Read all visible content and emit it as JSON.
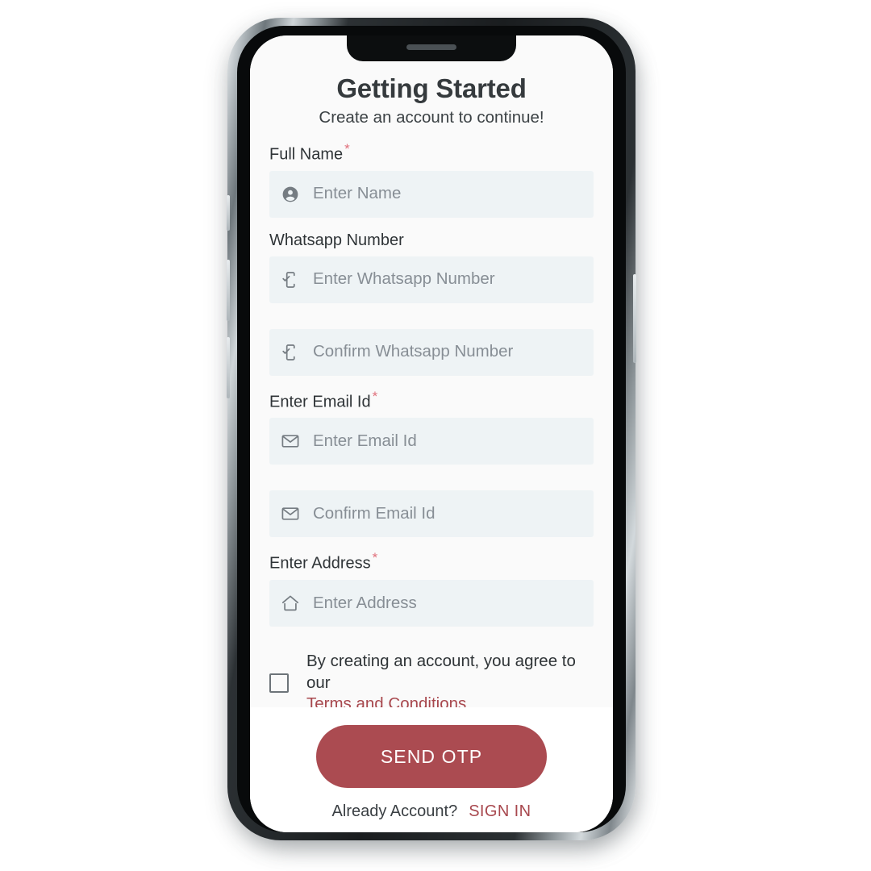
{
  "device": {
    "type": "smartphone-mockup",
    "notch": true,
    "speaker_grille": true
  },
  "screen": {
    "header": {
      "title": "Getting Started",
      "subtitle": "Create an account to continue!"
    },
    "fields": [
      {
        "label": "Full Name",
        "required": true,
        "icon": "person-icon",
        "placeholder": "Enter Name",
        "value": ""
      },
      {
        "label": "Whatsapp Number",
        "required": false,
        "icon": "mobile-check-icon",
        "placeholder": "Enter Whatsapp Number",
        "value": ""
      },
      {
        "label": "",
        "required": false,
        "icon": "mobile-check-icon",
        "placeholder": "Confirm Whatsapp Number",
        "value": ""
      },
      {
        "label": "Enter Email Id",
        "required": true,
        "icon": "envelope-icon",
        "placeholder": "Enter Email Id",
        "value": ""
      },
      {
        "label": "",
        "required": false,
        "icon": "envelope-icon",
        "placeholder": "Confirm Email Id",
        "value": ""
      },
      {
        "label": "Enter Address",
        "required": true,
        "icon": "home-icon",
        "placeholder": "Enter Address",
        "value": ""
      }
    ],
    "terms": {
      "checked": false,
      "text": "By creating an account, you agree to our",
      "link_label": "Terms and Conditions"
    },
    "footer": {
      "primary_button": "SEND OTP",
      "signin_prompt": "Already Account?",
      "signin_link": "SIGN IN"
    }
  },
  "colors": {
    "accent": "#a8484e",
    "button": "#ab4b51",
    "required_asterisk": "#e0707c",
    "input_background": "#eef3f5",
    "placeholder_text": "#878e95",
    "screen_background": "#fafafa",
    "footer_background": "#ffffff"
  }
}
